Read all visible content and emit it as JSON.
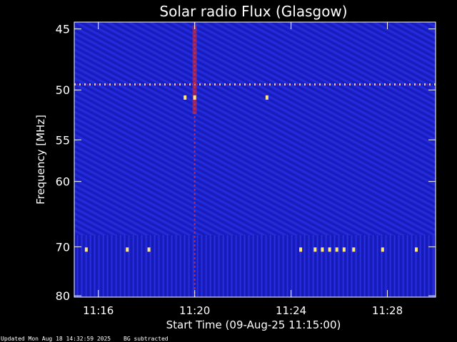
{
  "chart_data": {
    "type": "heatmap",
    "title": "Solar radio Flux (Glasgow)",
    "xlabel": "Start Time (09-Aug-25 11:15:00)",
    "ylabel": "Frequency [MHz]",
    "x_ticks": [
      {
        "label": "11:16",
        "minutes": 1
      },
      {
        "label": "11:20",
        "minutes": 5
      },
      {
        "label": "11:24",
        "minutes": 9
      },
      {
        "label": "11:28",
        "minutes": 13
      }
    ],
    "xlim_minutes": [
      0,
      15
    ],
    "y_ticks": [
      {
        "label": "45",
        "mhz": 45
      },
      {
        "label": "50",
        "mhz": 50
      },
      {
        "label": "55",
        "mhz": 55
      },
      {
        "label": "60",
        "mhz": 60
      },
      {
        "label": "70",
        "mhz": 70
      },
      {
        "label": "80",
        "mhz": 80
      }
    ],
    "ylim_mhz": [
      44.5,
      80.3
    ],
    "y_scale": "reciprocal",
    "background_color": "#1a1fc8",
    "colors": {
      "low": "#16189e",
      "mid": "#2a3af0",
      "burst": "#e02a2a",
      "hot": "#ffe680"
    },
    "features": [
      {
        "kind": "persistent-interference",
        "mhz": 49.5,
        "color": "hot"
      },
      {
        "kind": "vertical-burst",
        "minutes": 5.0,
        "color": "burst"
      },
      {
        "kind": "interference-blips",
        "mhz": 70.5,
        "minutes": [
          0.5,
          2.2,
          3.1,
          9.4,
          10.0,
          10.3,
          10.6,
          10.9,
          11.2,
          11.6,
          12.8,
          14.2
        ],
        "color": "hot"
      },
      {
        "kind": "interference-blips",
        "mhz": 50.7,
        "minutes": [
          4.6,
          5.0,
          8.0
        ],
        "color": "hot"
      }
    ]
  },
  "footer": {
    "updated": "Updated Mon Aug 18 14:32:59 2025",
    "note": "BG subtracted"
  }
}
